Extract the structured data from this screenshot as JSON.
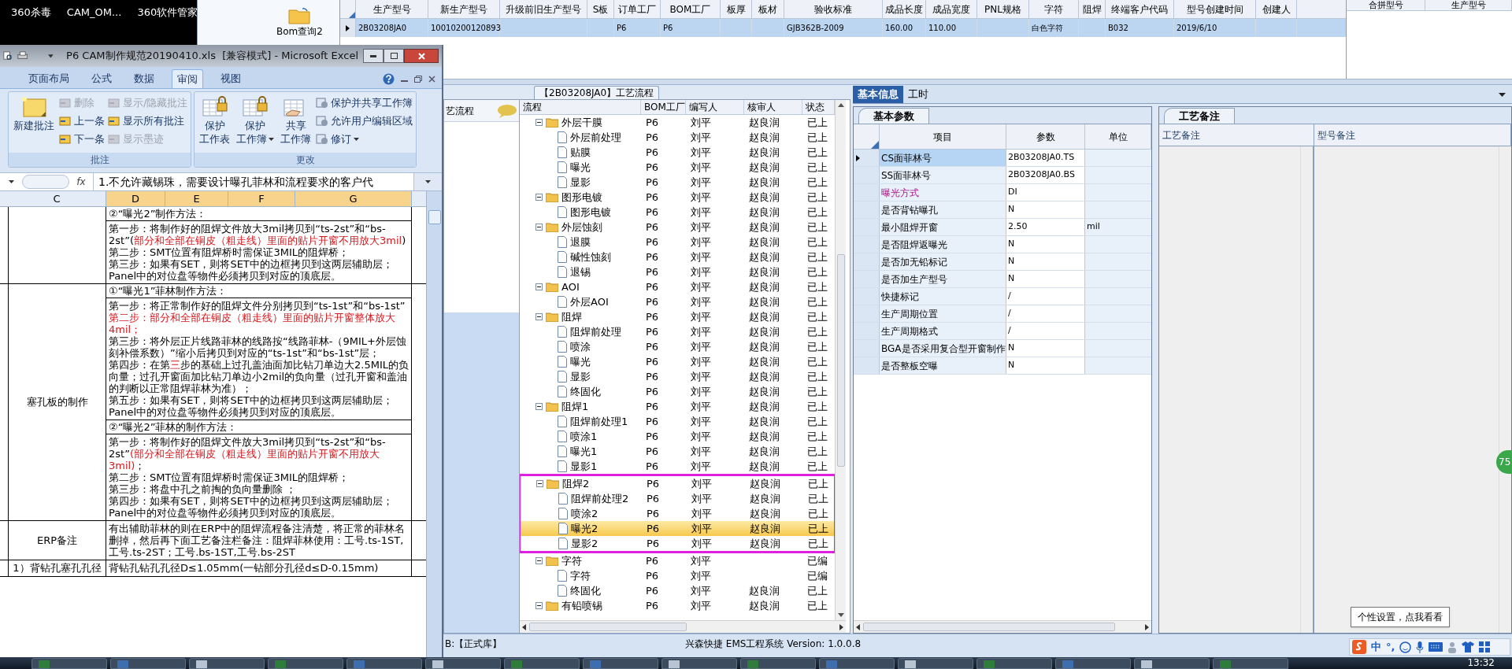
{
  "desktop_icons": [
    {
      "label": "360杀毒"
    },
    {
      "label": "CAM_OM..."
    },
    {
      "label": "360软件管家"
    }
  ],
  "toolbar": {
    "button": "Bom查询2"
  },
  "product_table": {
    "columns": [
      "生产型号",
      "新生产型号",
      "升级前旧生产型号",
      "S板",
      "订单工厂",
      "BOM工厂",
      "板厚",
      "板材",
      "验收标准",
      "成品长度",
      "成品宽度",
      "PNL规格",
      "字符",
      "阻焊",
      "终端客户代码",
      "型号创建时间",
      "创建人"
    ],
    "rows": [
      {
        "selected": true,
        "cells": [
          "2B03208JA0",
          "10010200120893",
          "",
          "",
          "P6",
          "P6",
          "",
          "",
          "GJB362B-2009",
          "160.00",
          "110.00",
          "",
          "白色字符",
          "",
          "B032",
          "2019/6/10",
          ""
        ]
      }
    ]
  },
  "merge_panel": {
    "columns": [
      "合拼型号",
      "生产型号"
    ]
  },
  "process_panel": {
    "title": "【2B03208JA0】工艺流程",
    "side_tab": "艺流程",
    "columns": [
      "流程",
      "BOM工厂",
      "编写人",
      "核审人",
      "状态"
    ],
    "tree": [
      {
        "name": "外层干膜",
        "factory": "P6",
        "writer": "刘平",
        "reviewer": "赵良润",
        "status": "已上",
        "expanded": true,
        "annotated": false,
        "selected": false,
        "children": [
          {
            "name": "外层前处理",
            "factory": "P6",
            "writer": "刘平",
            "reviewer": "赵良润",
            "status": "已上",
            "selected": false
          },
          {
            "name": "贴膜",
            "factory": "P6",
            "writer": "刘平",
            "reviewer": "赵良润",
            "status": "已上",
            "selected": false
          },
          {
            "name": "曝光",
            "factory": "P6",
            "writer": "刘平",
            "reviewer": "赵良润",
            "status": "已上",
            "selected": false
          },
          {
            "name": "显影",
            "factory": "P6",
            "writer": "刘平",
            "reviewer": "赵良润",
            "status": "已上",
            "selected": false
          }
        ]
      },
      {
        "name": "图形电镀",
        "factory": "P6",
        "writer": "刘平",
        "reviewer": "赵良润",
        "status": "已上",
        "expanded": true,
        "annotated": false,
        "selected": false,
        "children": [
          {
            "name": "图形电镀",
            "factory": "P6",
            "writer": "刘平",
            "reviewer": "赵良润",
            "status": "已上",
            "selected": false
          }
        ]
      },
      {
        "name": "外层蚀刻",
        "factory": "P6",
        "writer": "刘平",
        "reviewer": "赵良润",
        "status": "已上",
        "expanded": true,
        "annotated": false,
        "selected": false,
        "children": [
          {
            "name": "退膜",
            "factory": "P6",
            "writer": "刘平",
            "reviewer": "赵良润",
            "status": "已上",
            "selected": false
          },
          {
            "name": "碱性蚀刻",
            "factory": "P6",
            "writer": "刘平",
            "reviewer": "赵良润",
            "status": "已上",
            "selected": false
          },
          {
            "name": "退锡",
            "factory": "P6",
            "writer": "刘平",
            "reviewer": "赵良润",
            "status": "已上",
            "selected": false
          }
        ]
      },
      {
        "name": "AOI",
        "factory": "P6",
        "writer": "刘平",
        "reviewer": "赵良润",
        "status": "已上",
        "expanded": true,
        "annotated": false,
        "selected": false,
        "children": [
          {
            "name": "外层AOI",
            "factory": "P6",
            "writer": "刘平",
            "reviewer": "赵良润",
            "status": "已上",
            "selected": false
          }
        ]
      },
      {
        "name": "阻焊",
        "factory": "P6",
        "writer": "刘平",
        "reviewer": "赵良润",
        "status": "已上",
        "expanded": true,
        "annotated": false,
        "selected": false,
        "children": [
          {
            "name": "阻焊前处理",
            "factory": "P6",
            "writer": "刘平",
            "reviewer": "赵良润",
            "status": "已上",
            "selected": false
          },
          {
            "name": "喷涂",
            "factory": "P6",
            "writer": "刘平",
            "reviewer": "赵良润",
            "status": "已上",
            "selected": false
          },
          {
            "name": "曝光",
            "factory": "P6",
            "writer": "刘平",
            "reviewer": "赵良润",
            "status": "已上",
            "selected": false
          },
          {
            "name": "显影",
            "factory": "P6",
            "writer": "刘平",
            "reviewer": "赵良润",
            "status": "已上",
            "selected": false
          },
          {
            "name": "终固化",
            "factory": "P6",
            "writer": "刘平",
            "reviewer": "赵良润",
            "status": "已上",
            "selected": false
          }
        ]
      },
      {
        "name": "阻焊1",
        "factory": "P6",
        "writer": "刘平",
        "reviewer": "赵良润",
        "status": "已上",
        "expanded": true,
        "annotated": false,
        "selected": false,
        "children": [
          {
            "name": "阻焊前处理1",
            "factory": "P6",
            "writer": "刘平",
            "reviewer": "赵良润",
            "status": "已上",
            "selected": false
          },
          {
            "name": "喷涂1",
            "factory": "P6",
            "writer": "刘平",
            "reviewer": "赵良润",
            "status": "已上",
            "selected": false
          },
          {
            "name": "曝光1",
            "factory": "P6",
            "writer": "刘平",
            "reviewer": "赵良润",
            "status": "已上",
            "selected": false
          },
          {
            "name": "显影1",
            "factory": "P6",
            "writer": "刘平",
            "reviewer": "赵良润",
            "status": "已上",
            "selected": false
          }
        ]
      },
      {
        "name": "阻焊2",
        "factory": "P6",
        "writer": "刘平",
        "reviewer": "赵良润",
        "status": "已上",
        "expanded": true,
        "annotated": true,
        "selected": false,
        "children": [
          {
            "name": "阻焊前处理2",
            "factory": "P6",
            "writer": "刘平",
            "reviewer": "赵良润",
            "status": "已上",
            "selected": false
          },
          {
            "name": "喷涂2",
            "factory": "P6",
            "writer": "刘平",
            "reviewer": "赵良润",
            "status": "已上",
            "selected": false
          },
          {
            "name": "曝光2",
            "factory": "P6",
            "writer": "刘平",
            "reviewer": "赵良润",
            "status": "已上",
            "selected": true
          },
          {
            "name": "显影2",
            "factory": "P6",
            "writer": "刘平",
            "reviewer": "赵良润",
            "status": "已上",
            "selected": false
          }
        ]
      },
      {
        "name": "字符",
        "factory": "P6",
        "writer": "刘平",
        "status": "已编",
        "expanded": true,
        "annotated": false,
        "selected": false,
        "children": [
          {
            "name": "字符",
            "factory": "P6",
            "writer": "刘平",
            "status": "已编",
            "selected": false
          },
          {
            "name": "终固化",
            "factory": "P6",
            "writer": "刘平",
            "reviewer": "赵良润",
            "status": "已上",
            "selected": false
          }
        ]
      },
      {
        "name": "有铅喷锡",
        "factory": "P6",
        "writer": "刘平",
        "reviewer": "赵良润",
        "status": "已上",
        "expanded": true,
        "annotated": false,
        "selected": false
      }
    ]
  },
  "info_tabs": [
    {
      "label": "基本信息",
      "selected": true
    },
    {
      "label": "工时",
      "selected": false
    }
  ],
  "params_panel": {
    "tab": "基本参数",
    "columns": [
      "项目",
      "参数",
      "单位"
    ],
    "rows": [
      {
        "item": "CS面菲林号",
        "value": "2B03208JA0.TS",
        "emphasis": false,
        "selected": true
      },
      {
        "item": "SS面菲林号",
        "value": "2B03208JA0.BS",
        "emphasis": false,
        "selected": false
      },
      {
        "item": "曝光方式",
        "value": "DI",
        "emphasis": true,
        "selected": false
      },
      {
        "item": "是否背钻曝孔",
        "value": "N",
        "emphasis": false,
        "selected": false
      },
      {
        "item": "最小阻焊开窗",
        "value": "2.50",
        "unit": "mil",
        "emphasis": false,
        "selected": false
      },
      {
        "item": "是否阻焊返曝光",
        "value": "N",
        "emphasis": false,
        "selected": false
      },
      {
        "item": "是否加无铅标记",
        "value": "N",
        "emphasis": false,
        "selected": false
      },
      {
        "item": "是否加生产型号",
        "value": "N",
        "emphasis": false,
        "selected": false
      },
      {
        "item": "快捷标记",
        "value": "/",
        "emphasis": false,
        "selected": false
      },
      {
        "item": "生产周期位置",
        "value": "/",
        "emphasis": false,
        "selected": false
      },
      {
        "item": "生产周期格式",
        "value": "/",
        "emphasis": false,
        "selected": false
      },
      {
        "item": "BGA是否采用复合型开窗制作",
        "value": "N",
        "emphasis": false,
        "selected": false
      },
      {
        "item": "是否整板空曝",
        "value": "N",
        "emphasis": false,
        "selected": false
      }
    ]
  },
  "remarks_panel": {
    "tab": "工艺备注",
    "columns": [
      "工艺备注",
      "型号备注"
    ]
  },
  "status_bar": {
    "database": "B:【正式库】",
    "app": "兴森快捷 EMS工程系统 Version: 1.0.0.8"
  },
  "badge": "75",
  "tooltip": "个性设置，点我看看",
  "ime": {
    "mode": "中",
    "punct": "°,"
  },
  "excel": {
    "title": "P6 CAM制作规范20190410.xls  [兼容模式] - Microsoft Excel",
    "tabs": [
      {
        "label": "页面布局",
        "selected": false
      },
      {
        "label": "公式",
        "selected": false
      },
      {
        "label": "数据",
        "selected": false
      },
      {
        "label": "审阅",
        "selected": true
      },
      {
        "label": "视图",
        "selected": false
      }
    ],
    "groups": [
      {
        "label": "批注",
        "buttons": [
          {
            "kind": "large",
            "lines": [
              "新建批注"
            ],
            "disabled": false,
            "dropdown": false
          },
          {
            "kind": "small",
            "lines": [
              "删除"
            ],
            "disabled": true,
            "dropdown": false
          },
          {
            "kind": "small",
            "lines": [
              "上一条"
            ],
            "disabled": false,
            "dropdown": false
          },
          {
            "kind": "small",
            "lines": [
              "下一条"
            ],
            "disabled": false,
            "dropdown": false
          },
          {
            "kind": "small",
            "lines": [
              "显示/隐藏批注"
            ],
            "disabled": true,
            "dropdown": false
          },
          {
            "kind": "small",
            "lines": [
              "显示所有批注"
            ],
            "disabled": false,
            "dropdown": false
          },
          {
            "kind": "small",
            "lines": [
              "显示墨迹"
            ],
            "disabled": true,
            "dropdown": false
          }
        ]
      },
      {
        "label": "更改",
        "buttons": [
          {
            "kind": "large",
            "lines": [
              "保护",
              "工作表"
            ],
            "disabled": false,
            "dropdown": false
          },
          {
            "kind": "large",
            "lines": [
              "保护",
              "工作簿"
            ],
            "disabled": false,
            "dropdown": true
          },
          {
            "kind": "large",
            "lines": [
              "共享",
              "工作簿"
            ],
            "disabled": false,
            "dropdown": false
          },
          {
            "kind": "small",
            "lines": [
              "保护并共享工作簿"
            ],
            "disabled": false,
            "dropdown": false
          },
          {
            "kind": "small",
            "lines": [
              "允许用户编辑区域"
            ],
            "disabled": false,
            "dropdown": false
          },
          {
            "kind": "small",
            "lines": [
              "修订"
            ],
            "disabled": false,
            "dropdown": true
          }
        ]
      }
    ],
    "fx_label": "fx",
    "formula": "1.不允许藏锡珠，需要设计曝孔菲林和流程要求的客户代",
    "columns": [
      {
        "label": "C",
        "selected": false
      },
      {
        "label": "D",
        "selected": true
      },
      {
        "label": "E",
        "selected": true
      },
      {
        "label": "F",
        "selected": true
      },
      {
        "label": "G",
        "selected": true
      }
    ],
    "rows": [
      {
        "blocks": [
          {
            "kind": "title",
            "paras": [
              [
                {
                  "text": "②“曝光2”制作方法：",
                  "red": false
                }
              ]
            ]
          },
          {
            "kind": "body",
            "paras": [
              [
                {
                  "text": "第一步：将制作好的阻焊文件放大3mil拷贝到“ts-2st”和“bs-2st”(",
                  "red": false
                },
                {
                  "text": "部分和全部在铜皮（粗走线）里面的贴片开窗不用放大3mil",
                  "red": true
                },
                {
                  "text": ")",
                  "red": false
                }
              ],
              [
                {
                  "text": "第二步：SMT位置有阻焊桥时需保证3MIL的阻焊桥；",
                  "red": false
                }
              ],
              [
                {
                  "text": "第三步：如果有SET，则将SET中的边框拷贝到这两层辅助层；",
                  "red": false
                }
              ],
              [
                {
                  "text": "Panel中的对位盘等物件必须拷贝到对应的顶底层。",
                  "red": false
                }
              ]
            ]
          }
        ]
      },
      {
        "label": "塞孔板的制作",
        "blocks": [
          {
            "kind": "title",
            "paras": [
              [
                {
                  "text": "①“曝光1”菲林制作方法：",
                  "red": false
                }
              ]
            ]
          },
          {
            "kind": "body",
            "paras": [
              [
                {
                  "text": "第一步：将正常制作好的阻焊文件分别拷贝到“ts-1st”和“bs-1st”",
                  "red": false
                }
              ],
              [
                {
                  "text": "第二步：部分和全部在铜皮（粗走线）里面的贴片开窗整体放大4mil；",
                  "red": true
                }
              ],
              [
                {
                  "text": "第三步：将外层正片线路菲林的线路按“线路菲林-（9MIL+外层蚀刻补偿系数）”缩小后拷贝到对应的“ts-1st”和“bs-1st”层；",
                  "red": false
                }
              ],
              [
                {
                  "text": "第四步：在第",
                  "red": false
                },
                {
                  "text": "三",
                  "red": true
                },
                {
                  "text": "步的基础上过孔盖油面加比钻刀单边大2.5MIL的负向量；过孔开窗面加比钻刀单边小2mil的负向量（过孔开窗和盖油的判断以正常阻焊菲林为准）；",
                  "red": false
                }
              ],
              [
                {
                  "text": "第五步：如果有SET，则将SET中的边框拷贝到这两层辅助层；",
                  "red": false
                }
              ],
              [
                {
                  "text": "Panel中的对位盘等物件必须拷贝到对应的顶底层。",
                  "red": false
                }
              ]
            ]
          },
          {
            "kind": "title",
            "paras": [
              [
                {
                  "text": "②“曝光2”菲林的制作方法：",
                  "red": false
                }
              ]
            ]
          },
          {
            "kind": "body",
            "paras": [
              [
                {
                  "text": "第一步：将制作好的阻焊文件放大3mil拷贝到“ts-2st”和“bs-2st”",
                  "red": false
                },
                {
                  "text": "(部分和全部在铜皮（粗走线）里面的贴片开窗不用放大3mil)",
                  "red": true
                },
                {
                  "text": "；",
                  "red": false
                }
              ],
              [
                {
                  "text": "第二步：SMT位置有阻焊桥时需保证3MIL的阻焊桥；",
                  "red": false
                }
              ],
              [
                {
                  "text": "第三步：将盘中孔之前掏的负向量删除 ；",
                  "red": false
                }
              ],
              [
                {
                  "text": "第四步：如果有SET，则将SET中的边框拷贝到这两层辅助层；",
                  "red": false
                }
              ],
              [
                {
                  "text": "Panel中的对位盘等物件必须拷贝到对应的顶底层。",
                  "red": false
                }
              ]
            ]
          }
        ]
      },
      {
        "label": "ERP备注",
        "blocks": [
          {
            "kind": "body",
            "paras": [
              [
                {
                  "text": "有出辅助菲林的则在ERP中的阻焊流程备注清楚，将正常的菲林名删掉，然后再下面工艺备注栏备注：阻焊菲林使用：工号.ts-1ST,工号.ts-2ST；工号.bs-1ST,工号.bs-2ST",
                  "red": false
                }
              ]
            ]
          }
        ]
      },
      {
        "label": "1）背钻孔塞孔孔径",
        "blocks": [
          {
            "kind": "body",
            "paras": [
              [
                {
                  "text": "背钻孔钻孔孔径D≤1.05mm(一钻部分孔径d≤D-0.15mm)",
                  "red": false
                }
              ]
            ]
          }
        ]
      }
    ]
  },
  "taskbar": {
    "time": "13:32"
  }
}
